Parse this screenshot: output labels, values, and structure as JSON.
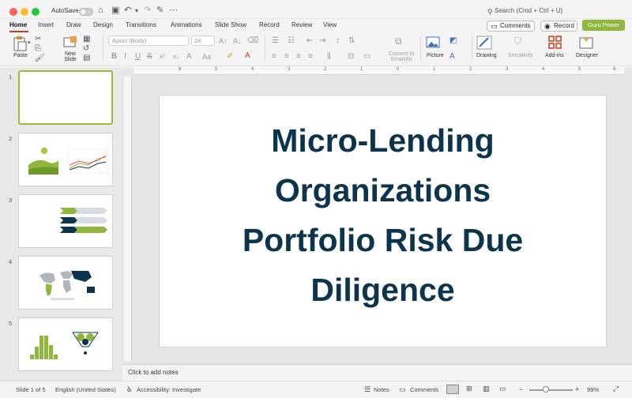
{
  "titlebar": {
    "autosave_label": "AutoSave",
    "search_placeholder": "Search (Cmd + Ctrl + U)"
  },
  "tabs": [
    "Home",
    "Insert",
    "Draw",
    "Design",
    "Transitions",
    "Animations",
    "Slide Show",
    "Record",
    "Review",
    "View"
  ],
  "tab_actions": {
    "comments": "Comments",
    "record": "Record",
    "guru": "Guru Power"
  },
  "ribbon": {
    "paste": "Paste",
    "new_slide": "New Slide",
    "font_name": "Aptos (Body)",
    "font_size": "24",
    "convert_smartart": "Convert to SmartArt",
    "picture": "Picture",
    "drawing": "Drawing",
    "sensitivity": "Sensitivity",
    "addins": "Add-ins",
    "designer": "Designer"
  },
  "ruler": [
    "6",
    "5",
    "4",
    "3",
    "2",
    "1",
    "0",
    "1",
    "2",
    "3",
    "4",
    "5",
    "6"
  ],
  "thumbnails": [
    {
      "num": "1"
    },
    {
      "num": "2"
    },
    {
      "num": "3"
    },
    {
      "num": "4"
    },
    {
      "num": "5"
    }
  ],
  "slide": {
    "title_lines": [
      "Micro-Lending",
      "Organizations",
      "Portfolio Risk Due",
      "Diligence"
    ]
  },
  "notes": {
    "placeholder": "Click to add notes"
  },
  "status": {
    "slide_info": "Slide 1 of 5",
    "language": "English (United States)",
    "accessibility": "Accessibility: Investigate",
    "notes": "Notes",
    "comments": "Comments",
    "zoom": "99%"
  },
  "colors": {
    "title": "#0c354d",
    "accent_green": "#8fb73c",
    "active_tab_underline": "#c43e1c"
  }
}
